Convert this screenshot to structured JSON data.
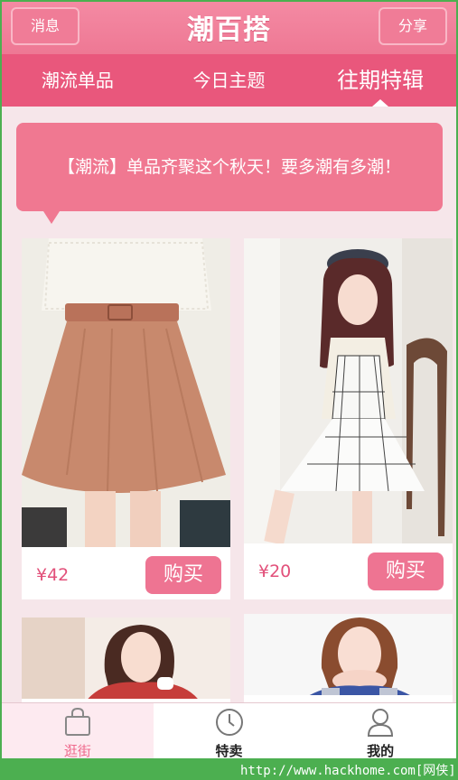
{
  "header": {
    "left_button": "消息",
    "title": "潮百搭",
    "right_button": "分享"
  },
  "tabs": [
    {
      "label": "潮流单品",
      "active": false
    },
    {
      "label": "今日主题",
      "active": false
    },
    {
      "label": "往期特辑",
      "active": true
    }
  ],
  "banner": {
    "text": "【潮流】单品齐聚这个秋天！要多潮有多潮！"
  },
  "products": [
    {
      "price": "¥42",
      "buy_label": "购买",
      "image": "brown-flared-skirt-photo"
    },
    {
      "price": "¥20",
      "buy_label": "购买",
      "image": "plaid-dress-beret-photo"
    },
    {
      "image": "red-top-girl-photo"
    },
    {
      "image": "hands-to-face-girl-photo"
    }
  ],
  "bottom_nav": [
    {
      "label": "逛街",
      "icon": "shopping-bag-icon",
      "active": true
    },
    {
      "label": "特卖",
      "icon": "clock-icon",
      "active": false
    },
    {
      "label": "我的",
      "icon": "user-icon",
      "active": false
    }
  ],
  "watermark": "http://www.hackhome.com[网侠]提供",
  "colors": {
    "accent": "#e9577c",
    "header": "#f07c97",
    "price": "#e2507a"
  }
}
